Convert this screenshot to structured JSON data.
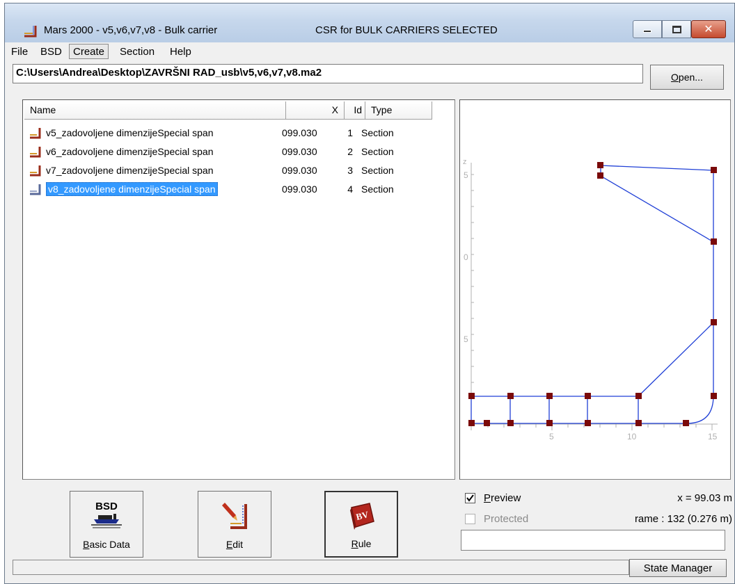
{
  "window": {
    "title": "Mars 2000 - v5,v6,v7,v8 - Bulk carrier",
    "subtitle": "CSR for BULK CARRIERS SELECTED",
    "close_glyph": "✕"
  },
  "menu": {
    "items": [
      "File",
      "BSD",
      "Create",
      "Section",
      "Help"
    ],
    "active": "Create"
  },
  "file": {
    "path": "C:\\Users\\Andrea\\Desktop\\ZAVRŠNI RAD_usb\\v5,v6,v7,v8.ma2",
    "open_label_underlined": "O",
    "open_label_rest": "pen..."
  },
  "list": {
    "columns": [
      "Name",
      "X",
      "Id",
      "Type"
    ],
    "rows": [
      {
        "name": "v5_zadovoljene dimenzijeSpecial span",
        "x": "099.030",
        "id": "1",
        "type": "Section"
      },
      {
        "name": "v6_zadovoljene dimenzijeSpecial span",
        "x": "099.030",
        "id": "2",
        "type": "Section"
      },
      {
        "name": "v7_zadovoljene dimenzijeSpecial span",
        "x": "099.030",
        "id": "3",
        "type": "Section"
      },
      {
        "name": "v8_zadovoljene dimenzijeSpecial span",
        "x": "099.030",
        "id": "4",
        "type": "Section",
        "selected": true
      }
    ]
  },
  "preview": {
    "x_ticks": [
      "5",
      "10",
      "15"
    ],
    "y_ticks": [
      "5",
      "0",
      "5"
    ],
    "z_axis_label": "z"
  },
  "buttons": {
    "basic_data": {
      "icon_text": "BSD",
      "label_u": "B",
      "label_rest": "asic Data"
    },
    "edit": {
      "label_u": "E",
      "label_rest": "dit"
    },
    "rule": {
      "icon_text": "BV",
      "label_u": "R",
      "label_rest": "ule"
    }
  },
  "options": {
    "preview_u": "P",
    "preview_rest": "review",
    "preview_checked": true,
    "protected": "Protected",
    "protected_checked": false
  },
  "readouts": {
    "x": "x = 99.03 m",
    "frame": "rame : 132 (0.276 m)"
  },
  "status": {
    "state_manager": "State Manager"
  },
  "colors": {
    "selection": "#3399ff",
    "section_line": "#1f3fd6",
    "node": "#7a0a0a"
  }
}
